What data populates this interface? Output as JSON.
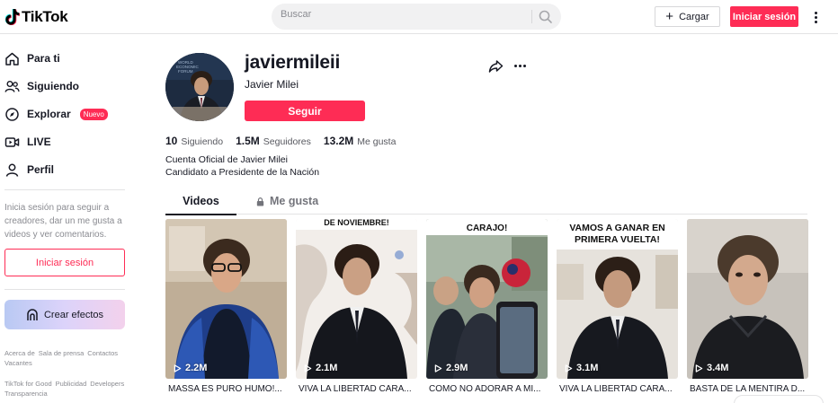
{
  "header": {
    "logo_text": "TikTok",
    "search_placeholder": "Buscar",
    "upload_label": "Cargar",
    "login_label": "Iniciar sesión"
  },
  "sidebar": {
    "items": [
      {
        "label": "Para ti",
        "icon": "home-icon"
      },
      {
        "label": "Siguiendo",
        "icon": "following-icon"
      },
      {
        "label": "Explorar",
        "icon": "compass-icon",
        "badge": "Nuevo"
      },
      {
        "label": "LIVE",
        "icon": "live-icon"
      },
      {
        "label": "Perfil",
        "icon": "profile-icon"
      }
    ],
    "login_prompt": "Inicia sesión para seguir a creadores, dar un me gusta a videos y ver comentarios.",
    "login_button": "Iniciar sesión",
    "create_effects": "Crear efectos",
    "footer_row1": [
      "Acerca de",
      "Sala de prensa",
      "Contactos",
      "Vacantes"
    ],
    "footer_row2": [
      "TikTok for Good",
      "Publicidad",
      "Developers",
      "Transparencia"
    ]
  },
  "profile": {
    "username": "javiermileii",
    "display_name": "Javier Milei",
    "follow_label": "Seguir",
    "stats": {
      "following_count": "10",
      "following_label": "Siguiendo",
      "followers_count": "1.5M",
      "followers_label": "Seguidores",
      "likes_count": "13.2M",
      "likes_label": "Me gusta"
    },
    "bio_line1": "Cuenta Oficial de Javier Milei",
    "bio_line2": "Candidato a Presidente de la Nación",
    "avatar_text": "WORLD ECONOMIC FORUM"
  },
  "tabs": {
    "videos": "Videos",
    "likes": "Me gusta"
  },
  "videos": [
    {
      "views": "2.2M",
      "title": "MASSA ES PURO HUMO!...",
      "overlay": ""
    },
    {
      "views": "2.1M",
      "title": "VIVA LA LIBERTAD CARA...",
      "overlay": "DE NOVIEMBRE!"
    },
    {
      "views": "2.9M",
      "title": "COMO NO ADORAR A MI...",
      "overlay": "CARAJO!"
    },
    {
      "views": "3.1M",
      "title": "VIVA LA LIBERTAD CARA...",
      "overlay": "VAMOS A GANAR EN PRIMERA VUELTA!"
    },
    {
      "views": "3.4M",
      "title": "BASTA DE LA MENTIRA D...",
      "overlay": ""
    }
  ],
  "colors": {
    "brand": "#fe2c55",
    "text": "#161823",
    "muted": "#8a8b91"
  }
}
